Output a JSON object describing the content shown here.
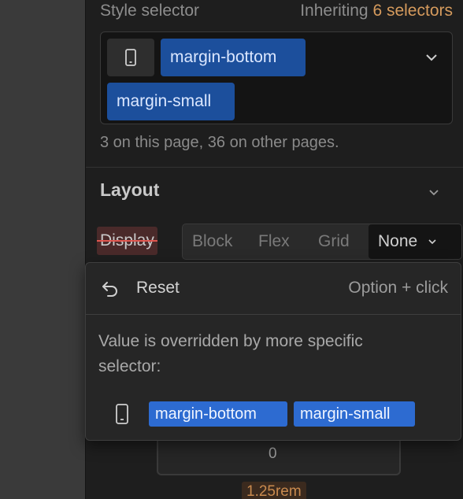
{
  "style_selector": {
    "label": "Style selector",
    "inheriting_prefix": "Inheriting",
    "inheriting_count": "6 selectors",
    "breakpoint_icon": "phone-icon",
    "chips": [
      "margin-bottom",
      "margin-small"
    ],
    "page_count_text": "3 on this page, 36 on other pages."
  },
  "layout": {
    "title": "Layout",
    "display_label": "Display",
    "display_options": [
      "Block",
      "Flex",
      "Grid",
      "None"
    ],
    "display_selected": "None"
  },
  "popover": {
    "reset_label": "Reset",
    "shortcut": "Option + click",
    "message": "Value is overridden by more specific selector:",
    "breakpoint_icon": "phone-icon",
    "chips": [
      "margin-bottom",
      "margin-small"
    ]
  },
  "background": {
    "zero_value": "0",
    "rem_value": "1.25rem"
  },
  "colors": {
    "chip_bg": "#1c4f9c",
    "popover_chip_bg": "#2d6bd1",
    "accent": "#d69b5d",
    "strike": "#e0564f"
  }
}
